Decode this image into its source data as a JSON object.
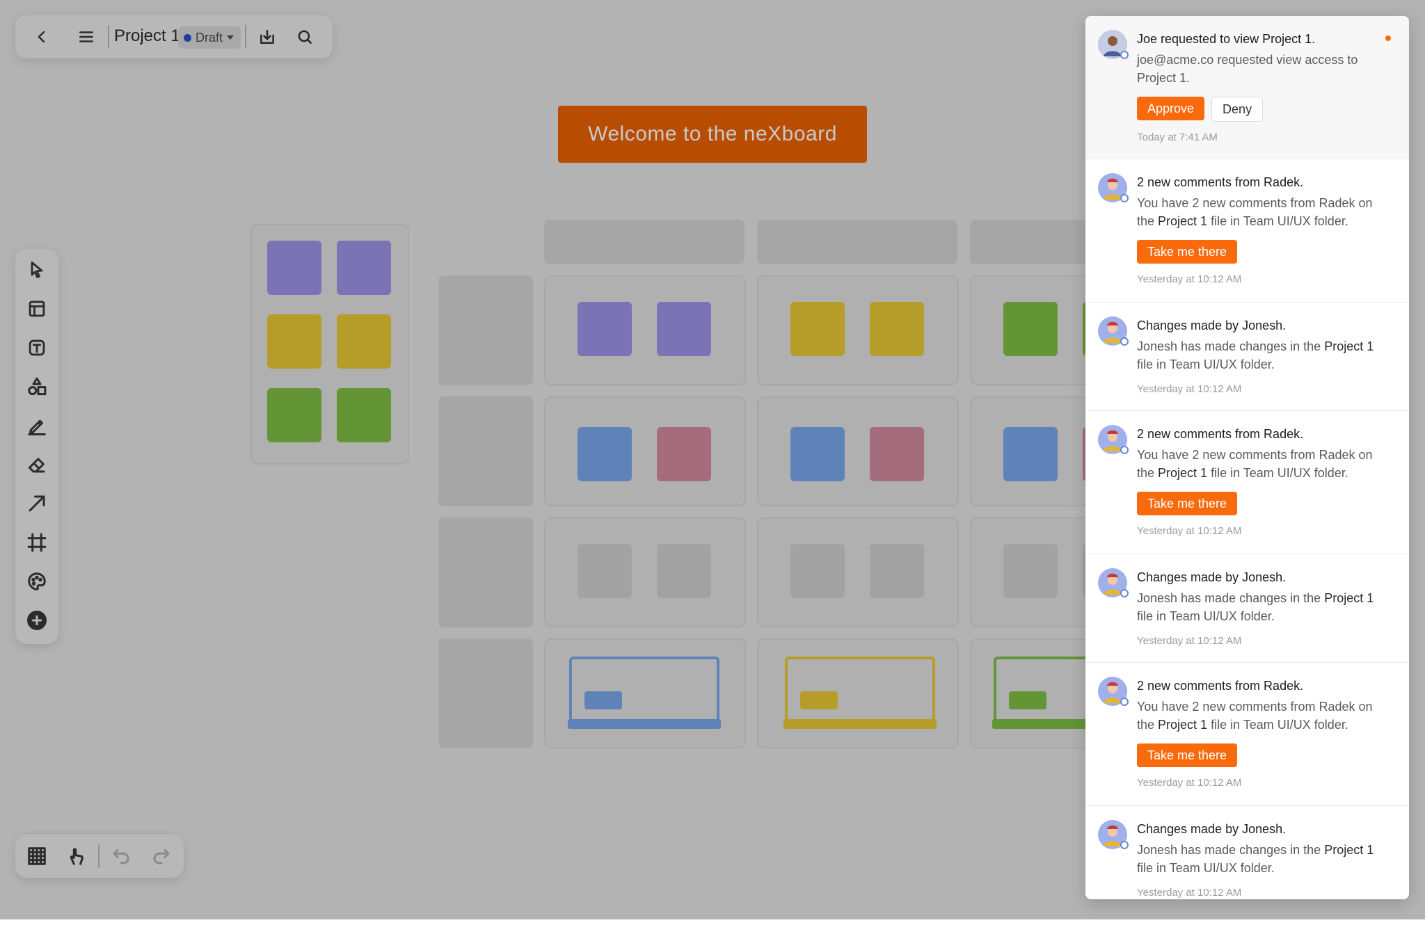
{
  "header": {
    "back_icon": "chevron-left-icon",
    "menu_icon": "hamburger-icon",
    "project_name": "Project 1",
    "status": "Draft",
    "status_color": "#1f3f9f",
    "download_icon": "download-icon",
    "search_icon": "search-icon"
  },
  "canvas": {
    "welcome_text": "Welcome to the neXboard",
    "banner_color": "#b84c00"
  },
  "left_toolbar": {
    "tools": [
      "select-tool",
      "template-tool",
      "text-tool",
      "shapes-tool",
      "pen-tool",
      "eraser-tool",
      "arrow-tool",
      "frame-tool",
      "sticker-tool",
      "add-tool"
    ]
  },
  "bottom_toolbar": {
    "tools": [
      "grid-tool",
      "pointer-tool",
      "undo",
      "redo"
    ]
  },
  "notifications": [
    {
      "title": "Joe requested to view Project 1.",
      "body_pre": "joe@acme.co requested view access to Project 1.",
      "body_bold": "",
      "body_post": "",
      "primary_action": "Approve",
      "secondary_action": "Deny",
      "time": "Today at 7:41 AM",
      "unread": true
    },
    {
      "title": "2 new comments from Radek.",
      "body_pre": "You have 2 new comments from Radek on the ",
      "body_bold": "Project 1",
      "body_post": " file in Team UI/UX folder.",
      "primary_action": "Take me there",
      "time": "Yesterday at 10:12 AM"
    },
    {
      "title": "Changes made by Jonesh.",
      "body_pre": "Jonesh has made changes in the ",
      "body_bold": "Project 1",
      "body_post": " file in Team UI/UX folder.",
      "time": "Yesterday at 10:12 AM"
    },
    {
      "title": "2 new comments from Radek.",
      "body_pre": "You have 2 new comments from Radek on the ",
      "body_bold": "Project 1",
      "body_post": " file in Team UI/UX folder.",
      "primary_action": "Take me there",
      "time": "Yesterday at 10:12 AM"
    },
    {
      "title": "Changes made by Jonesh.",
      "body_pre": "Jonesh has made changes in the ",
      "body_bold": "Project 1",
      "body_post": " file in Team UI/UX folder.",
      "time": "Yesterday at 10:12 AM"
    },
    {
      "title": "2 new comments from Radek.",
      "body_pre": "You have 2 new comments from Radek on the ",
      "body_bold": "Project 1",
      "body_post": " file in Team UI/UX folder.",
      "primary_action": "Take me there",
      "time": "Yesterday at 10:12 AM"
    },
    {
      "title": "Changes made by Jonesh.",
      "body_pre": "Jonesh has made changes in the ",
      "body_bold": "Project 1",
      "body_post": " file in Team UI/UX folder.",
      "time": "Yesterday at 10:12 AM"
    }
  ],
  "accent_color": "#f96a0c"
}
